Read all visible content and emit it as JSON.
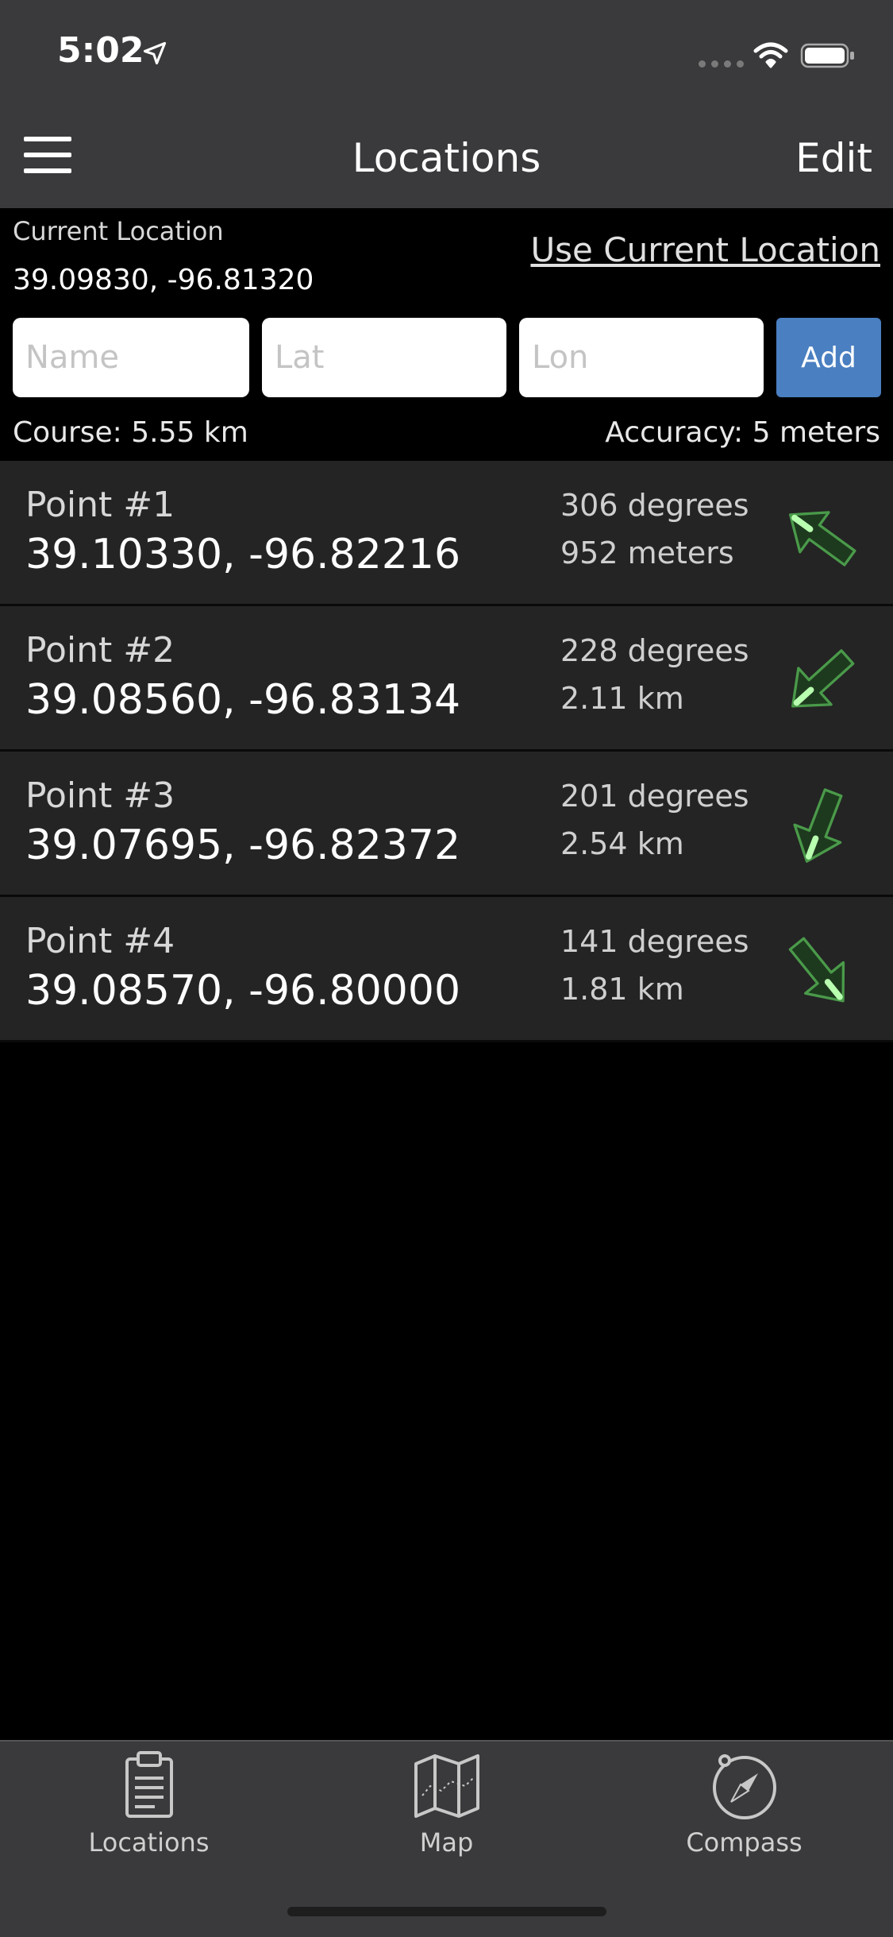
{
  "status": {
    "time": "5:02"
  },
  "nav": {
    "title": "Locations",
    "edit_label": "Edit"
  },
  "current": {
    "label": "Current Location",
    "coords": "39.09830, -96.81320",
    "use_current_label": "Use Current Location"
  },
  "form": {
    "name_placeholder": "Name",
    "lat_placeholder": "Lat",
    "lon_placeholder": "Lon",
    "add_label": "Add"
  },
  "course": "Course: 5.55 km",
  "accuracy": "Accuracy: 5 meters",
  "points": [
    {
      "name": "Point #1",
      "coords": "39.10330, -96.82216",
      "bearing": "306 degrees",
      "distance": "952 meters",
      "angle": 306
    },
    {
      "name": "Point #2",
      "coords": "39.08560, -96.83134",
      "bearing": "228 degrees",
      "distance": "2.11 km",
      "angle": 228
    },
    {
      "name": "Point #3",
      "coords": "39.07695, -96.82372",
      "bearing": "201 degrees",
      "distance": "2.54 km",
      "angle": 201
    },
    {
      "name": "Point #4",
      "coords": "39.08570, -96.80000",
      "bearing": "141 degrees",
      "distance": "1.81 km",
      "angle": 141
    }
  ],
  "tabs": [
    {
      "label": "Locations",
      "icon": "clipboard-icon"
    },
    {
      "label": "Map",
      "icon": "map-icon"
    },
    {
      "label": "Compass",
      "icon": "compass-icon"
    }
  ],
  "colors": {
    "accent": "#4a7fc1",
    "arrow": "#1e3a1e",
    "arrow_stroke": "#4a9a4a",
    "arrow_tip": "#b8ffb0"
  }
}
